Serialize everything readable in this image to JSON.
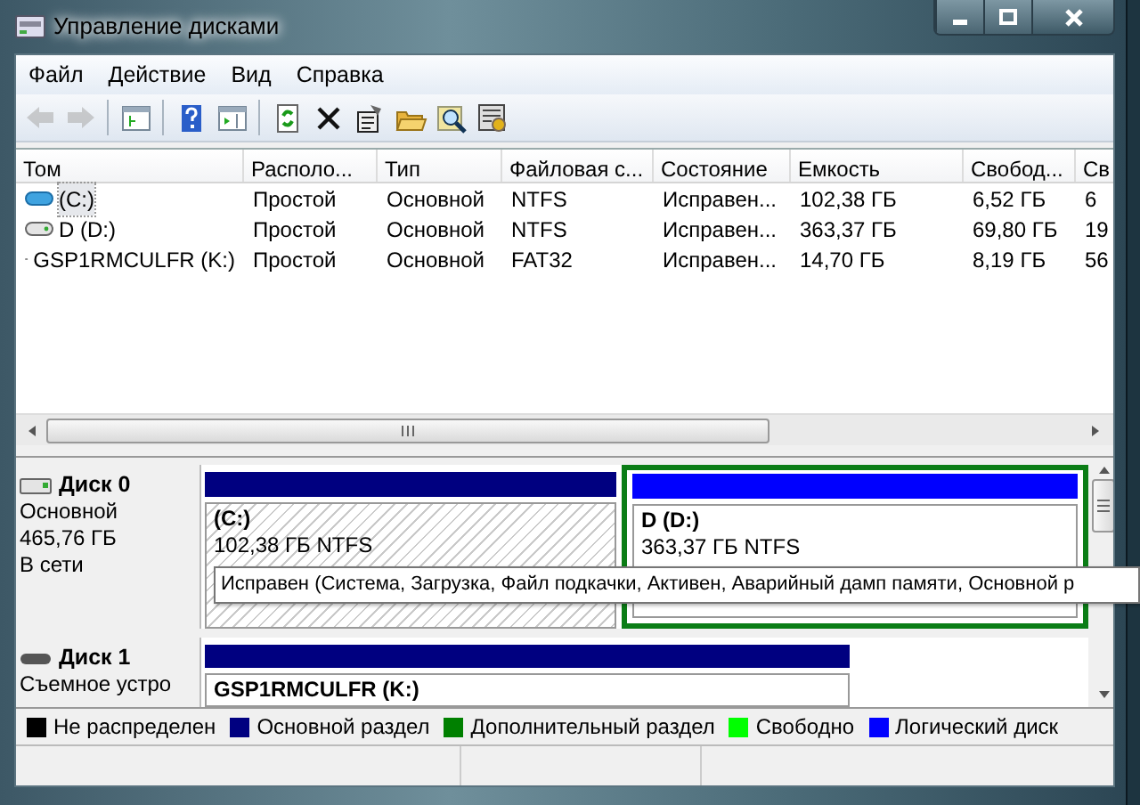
{
  "window": {
    "title": "Управление дисками"
  },
  "menu": [
    "Файл",
    "Действие",
    "Вид",
    "Справка"
  ],
  "toolbar": [
    {
      "kind": "back",
      "disabled": true
    },
    {
      "kind": "forward",
      "disabled": true
    },
    {
      "kind": "sep"
    },
    {
      "kind": "tree",
      "disabled": false
    },
    {
      "kind": "sep"
    },
    {
      "kind": "help",
      "disabled": false
    },
    {
      "kind": "pane",
      "disabled": false
    },
    {
      "kind": "sep"
    },
    {
      "kind": "refresh",
      "disabled": false
    },
    {
      "kind": "delete",
      "disabled": false
    },
    {
      "kind": "properties",
      "disabled": false
    },
    {
      "kind": "open",
      "disabled": false
    },
    {
      "kind": "search",
      "disabled": false
    },
    {
      "kind": "settings",
      "disabled": false
    }
  ],
  "table": {
    "columns": [
      "Том",
      "Располо...",
      "Тип",
      "Файловая с...",
      "Состояние",
      "Емкость",
      "Свобод...",
      "Св"
    ],
    "rows": [
      {
        "kind": "system",
        "selected": true,
        "cells": [
          "(C:)",
          "Простой",
          "Основной",
          "NTFS",
          "Исправен...",
          "102,38 ГБ",
          "6,52 ГБ",
          "6"
        ]
      },
      {
        "kind": "disk",
        "selected": false,
        "cells": [
          "D (D:)",
          "Простой",
          "Основной",
          "NTFS",
          "Исправен...",
          "363,37 ГБ",
          "69,80 ГБ",
          "19"
        ]
      },
      {
        "kind": "removable",
        "selected": false,
        "cells": [
          "GSP1RMCULFR (K:)",
          "Простой",
          "Основной",
          "FAT32",
          "Исправен...",
          "14,70 ГБ",
          "8,19 ГБ",
          "56"
        ]
      }
    ]
  },
  "disks": [
    {
      "kind": "fixed",
      "name": "Диск 0",
      "lines": [
        "Основной",
        "465,76 ГБ",
        "В сети"
      ],
      "partitions": [
        {
          "kind": "primary",
          "selected": true,
          "name": "(C:)",
          "size": "102,38 ГБ NTFS"
        },
        {
          "kind": "logical",
          "selected": false,
          "name": "D  (D:)",
          "size": "363,37 ГБ NTFS"
        }
      ]
    },
    {
      "kind": "removable",
      "name": "Диск 1",
      "lines": [
        "Съемное устро"
      ],
      "partitions": [
        {
          "kind": "primary",
          "selected": false,
          "name": "GSP1RMCULFR  (K:)"
        }
      ]
    }
  ],
  "tooltip": "Исправен (Система, Загрузка, Файл подкачки, Активен, Аварийный дамп памяти, Основной р",
  "legend": [
    {
      "label": "Не распределен",
      "color": "#000000"
    },
    {
      "label": "Основной раздел",
      "color": "#000080"
    },
    {
      "label": "Дополнительный раздел",
      "color": "#008000"
    },
    {
      "label": "Свободно",
      "color": "#00ff00"
    },
    {
      "label": "Логический диск",
      "color": "#0000ff"
    }
  ]
}
